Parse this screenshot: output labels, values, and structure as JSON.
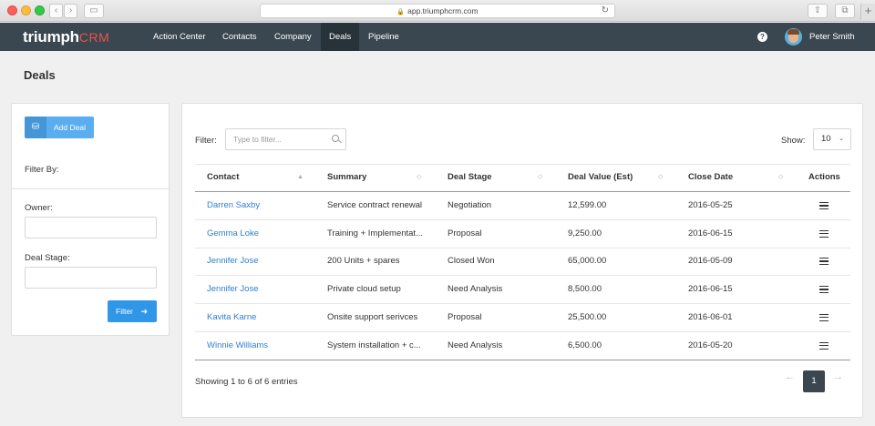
{
  "browser": {
    "url": "app.triumphcrm.com"
  },
  "brand": {
    "name": "triumph",
    "suffix": "CRM"
  },
  "nav": {
    "items": [
      "Action Center",
      "Contacts",
      "Company",
      "Deals",
      "Pipeline"
    ],
    "active": "Deals",
    "user_name": "Peter Smith"
  },
  "page": {
    "title": "Deals"
  },
  "sidebar": {
    "add_deal_label": "Add Deal",
    "filter_by_label": "Filter By:",
    "owner_label": "Owner:",
    "owner_value": "",
    "deal_stage_label": "Deal Stage:",
    "deal_stage_value": "",
    "filter_button_label": "Filter"
  },
  "table": {
    "filter_label": "Filter:",
    "filter_placeholder": "Type to filter...",
    "show_label": "Show:",
    "show_value": "10",
    "columns": [
      "Contact",
      "Summary",
      "Deal Stage",
      "Deal Value (Est)",
      "Close Date",
      "Actions"
    ],
    "rows": [
      {
        "contact": "Darren Saxby",
        "summary": "Service contract renewal",
        "stage": "Negotiation",
        "value": "12,599.00",
        "close_date": "2016-05-25"
      },
      {
        "contact": "Gemma Loke",
        "summary": "Training + Implementat...",
        "stage": "Proposal",
        "value": "9,250.00",
        "close_date": "2016-06-15"
      },
      {
        "contact": "Jennifer Jose",
        "summary": "200 Units + spares",
        "stage": "Closed Won",
        "value": "65,000.00",
        "close_date": "2016-05-09"
      },
      {
        "contact": "Jennifer Jose",
        "summary": "Private cloud setup",
        "stage": "Need Analysis",
        "value": "8,500.00",
        "close_date": "2016-06-15"
      },
      {
        "contact": "Kavita Karne",
        "summary": "Onsite support serivces",
        "stage": "Proposal",
        "value": "25,500.00",
        "close_date": "2016-06-01"
      },
      {
        "contact": "Winnie Williams",
        "summary": "System installation + c...",
        "stage": "Need Analysis",
        "value": "6,500.00",
        "close_date": "2016-05-20"
      }
    ],
    "info": "Showing 1 to 6 of 6 entries",
    "pagination": {
      "prev": "←",
      "current": "1",
      "next": "→"
    }
  },
  "colors": {
    "nav_bg": "#3a4750",
    "accent": "#2f96e8",
    "link": "#2f7fd0",
    "brand_crm": "#e8534a"
  }
}
